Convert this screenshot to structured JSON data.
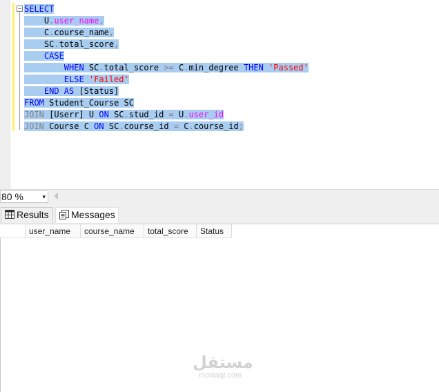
{
  "editor": {
    "collapse_glyph": "−",
    "lines": [
      [
        {
          "c": "kw",
          "t": "SELECT"
        }
      ],
      [
        {
          "c": "id",
          "t": "    U"
        },
        {
          "c": "op",
          "t": "."
        },
        {
          "c": "fn",
          "t": "user_name"
        },
        {
          "c": "op",
          "t": ","
        }
      ],
      [
        {
          "c": "id",
          "t": "    C"
        },
        {
          "c": "op",
          "t": "."
        },
        {
          "c": "id",
          "t": "course_name"
        },
        {
          "c": "op",
          "t": ","
        }
      ],
      [
        {
          "c": "id",
          "t": "    SC"
        },
        {
          "c": "op",
          "t": "."
        },
        {
          "c": "id",
          "t": "total_score"
        },
        {
          "c": "op",
          "t": ","
        }
      ],
      [
        {
          "c": "kw",
          "t": "    CASE"
        }
      ],
      [
        {
          "c": "kw",
          "t": "        WHEN "
        },
        {
          "c": "id",
          "t": "SC"
        },
        {
          "c": "op",
          "t": "."
        },
        {
          "c": "id",
          "t": "total_score "
        },
        {
          "c": "op",
          "t": ">="
        },
        {
          "c": "id",
          "t": " C"
        },
        {
          "c": "op",
          "t": "."
        },
        {
          "c": "id",
          "t": "min_degree "
        },
        {
          "c": "kw",
          "t": "THEN "
        },
        {
          "c": "str",
          "t": "'Passed'"
        }
      ],
      [
        {
          "c": "kw",
          "t": "        ELSE "
        },
        {
          "c": "str",
          "t": "'Failed'"
        }
      ],
      [
        {
          "c": "kw",
          "t": "    END AS "
        },
        {
          "c": "id",
          "t": "[Status]"
        }
      ],
      [
        {
          "c": "kw",
          "t": "FROM "
        },
        {
          "c": "id",
          "t": "Student_Course SC"
        }
      ],
      [
        {
          "c": "op",
          "t": "JOIN "
        },
        {
          "c": "id",
          "t": "[Userr] U "
        },
        {
          "c": "kw",
          "t": "ON "
        },
        {
          "c": "id",
          "t": "SC"
        },
        {
          "c": "op",
          "t": "."
        },
        {
          "c": "id",
          "t": "stud_id "
        },
        {
          "c": "op",
          "t": "="
        },
        {
          "c": "id",
          "t": " U"
        },
        {
          "c": "op",
          "t": "."
        },
        {
          "c": "fn",
          "t": "user_id"
        }
      ],
      [
        {
          "c": "op",
          "t": "JOIN "
        },
        {
          "c": "id",
          "t": "Course C "
        },
        {
          "c": "kw",
          "t": "ON "
        },
        {
          "c": "id",
          "t": "SC"
        },
        {
          "c": "op",
          "t": "."
        },
        {
          "c": "id",
          "t": "course_id "
        },
        {
          "c": "op",
          "t": "="
        },
        {
          "c": "id",
          "t": " C"
        },
        {
          "c": "op",
          "t": "."
        },
        {
          "c": "id",
          "t": "course_id"
        },
        {
          "c": "op",
          "t": ";"
        }
      ]
    ]
  },
  "zoom": {
    "value": "80 %",
    "arrow": "▾"
  },
  "tabs": {
    "results": "Results",
    "messages": "Messages"
  },
  "grid": {
    "columns": [
      "user_name",
      "course_name",
      "total_score",
      "Status"
    ]
  },
  "watermark": {
    "arabic": "مستقل",
    "latin": "mostaql.com"
  },
  "colors": {
    "keyword": "#0000ff",
    "function": "#ff00ff",
    "string": "#ff0000",
    "operator": "#7f7f7f",
    "selection": "#a8cdf0",
    "change_bar": "#ffef6b"
  }
}
